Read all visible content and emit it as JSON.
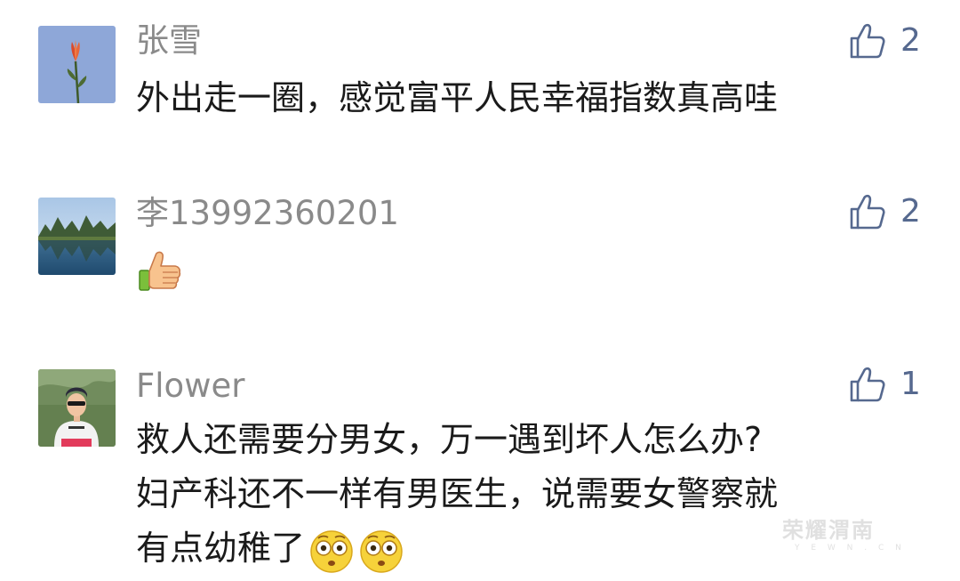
{
  "comments": [
    {
      "username": "张雪",
      "avatar_icon": "lily-flower-avatar",
      "content_lines": [
        "外出走一圈，感觉富平人民幸福指数真高哇"
      ],
      "likes": "2"
    },
    {
      "username": "李13992360201",
      "avatar_icon": "mountain-lake-avatar",
      "content_emoji": "thumbs-up-emoji",
      "likes": "2"
    },
    {
      "username": "Flower",
      "avatar_icon": "woman-portrait-avatar",
      "content_lines": [
        "救人还需要分男女，万一遇到坏人怎么办?",
        "妇产科还不一样有男医生，说需要女警察就",
        "有点幼稚了"
      ],
      "content_emoji": "flushed-face-emoji",
      "likes": "1"
    }
  ],
  "like_icon": "thumbs-up-outline-icon",
  "colors": {
    "username": "#8a8a8a",
    "content": "#1a1a1a",
    "like_accent": "#56698f"
  },
  "watermark": {
    "text": "荣耀渭南",
    "sub": "Y E W N . C N"
  }
}
